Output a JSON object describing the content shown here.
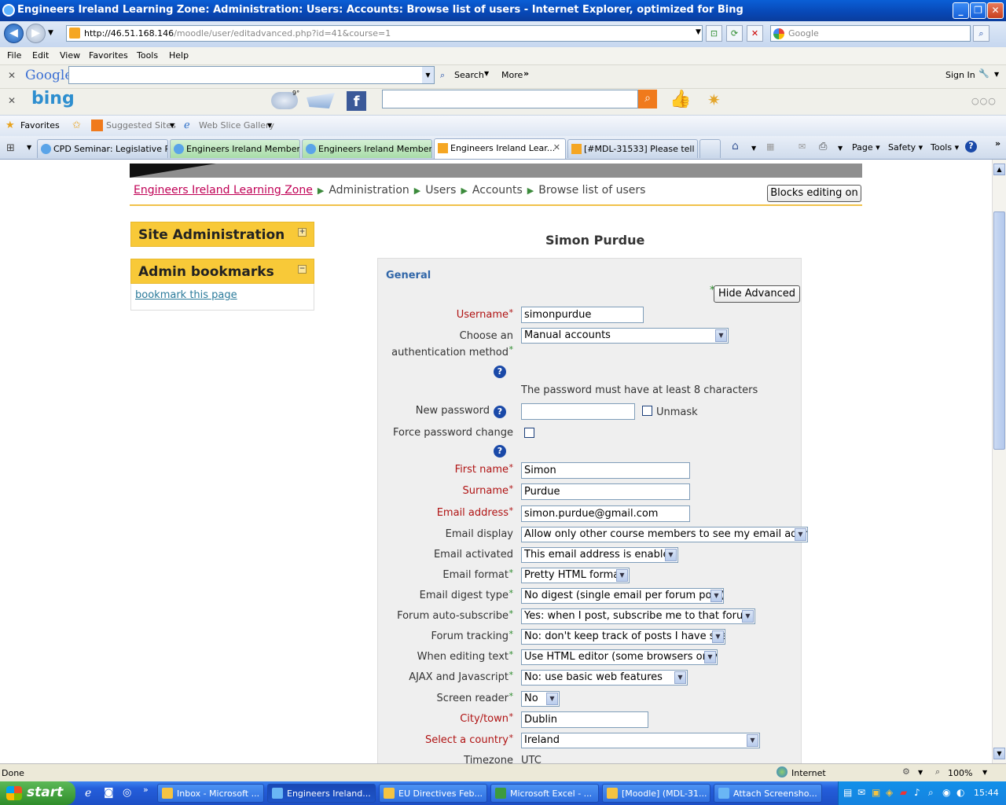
{
  "window": {
    "title": "Engineers Ireland Learning Zone: Administration: Users: Accounts: Browse list of users - Internet Explorer, optimized for Bing"
  },
  "address": {
    "url_host": "http://46.51.168.146",
    "url_path": "/moodle/user/editadvanced.php?id=41&course=1",
    "search_placeholder": "Google"
  },
  "menu": [
    "File",
    "Edit",
    "View",
    "Favorites",
    "Tools",
    "Help"
  ],
  "google_toolbar": {
    "logo": "Google",
    "search_label": "Search",
    "more_label": "More",
    "sign_in": "Sign In"
  },
  "bing_toolbar": {
    "logo": "bing",
    "weather": "9°"
  },
  "favorites_bar": {
    "favorites": "Favorites",
    "suggested": "Suggested Sites",
    "webslice": "Web Slice Gallery"
  },
  "tabs": [
    {
      "label": "CPD Seminar: Legislative R..."
    },
    {
      "label": "Engineers Ireland Members..."
    },
    {
      "label": "Engineers Ireland Members..."
    },
    {
      "label": "Engineers Ireland Lear..."
    },
    {
      "label": "[#MDL-31533] Please tell ..."
    }
  ],
  "command_bar": {
    "page": "Page",
    "safety": "Safety",
    "tools": "Tools"
  },
  "breadcrumb": {
    "home": "Engineers Ireland Learning Zone",
    "items": [
      "Administration",
      "Users",
      "Accounts",
      "Browse list of users"
    ]
  },
  "blocks_button": "Blocks editing on",
  "site_admin_block": {
    "title": "Site Administration"
  },
  "admin_bookmarks_block": {
    "title": "Admin bookmarks",
    "link": "bookmark this page"
  },
  "user_fullname": "Simon Purdue",
  "form": {
    "legend": "General",
    "hide_advanced": "Hide Advanced",
    "username_label": "Username",
    "username": "simonpurdue",
    "auth_label_1": "Choose an",
    "auth_label_2": "authentication method",
    "auth": "Manual accounts",
    "password_note": "The password must have at least 8 characters",
    "newpass_label": "New password",
    "unmask_label": "Unmask",
    "force_label": "Force password change",
    "firstname_label": "First name",
    "firstname": "Simon",
    "surname_label": "Surname",
    "surname": "Purdue",
    "email_label": "Email address",
    "email": "simon.purdue@gmail.com",
    "emaildisplay_label": "Email display",
    "emaildisplay": "Allow only other course members to see my email address",
    "emailactivated_label": "Email activated",
    "emailactivated": "This email address is enabled",
    "emailformat_label": "Email format",
    "emailformat": "Pretty HTML format",
    "digest_label": "Email digest type",
    "digest": "No digest (single email per forum post)",
    "autosub_label": "Forum auto-subscribe",
    "autosub": "Yes: when I post, subscribe me to that forum",
    "tracking_label": "Forum tracking",
    "tracking": "No: don't keep track of posts I have seen",
    "editing_label": "When editing text",
    "editing": "Use HTML editor (some browsers only)",
    "ajax_label": "AJAX and Javascript",
    "ajax": "No: use basic web features",
    "screenreader_label": "Screen reader",
    "screenreader": "No",
    "city_label": "City/town",
    "city": "Dublin",
    "country_label": "Select a country",
    "country": "Ireland",
    "timezone_label": "Timezone",
    "timezone": "UTC"
  },
  "status": {
    "left": "Done",
    "zone": "Internet",
    "zoom": "100%"
  },
  "taskbar": {
    "start": "start",
    "buttons": [
      "Inbox - Microsoft ...",
      "Engineers Ireland...",
      "EU Directives Feb...",
      "Microsoft Excel - ...",
      "[Moodle] (MDL-31...",
      "Attach Screensho..."
    ],
    "clock": "15:44"
  }
}
